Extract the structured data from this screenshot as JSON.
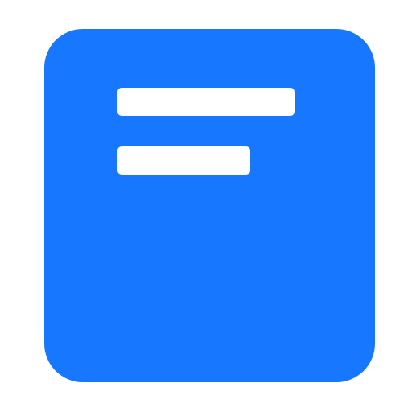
{
  "icon": {
    "name": "document-text-icon",
    "background_color": "#1877FF",
    "line_color": "#FFFFFF"
  }
}
